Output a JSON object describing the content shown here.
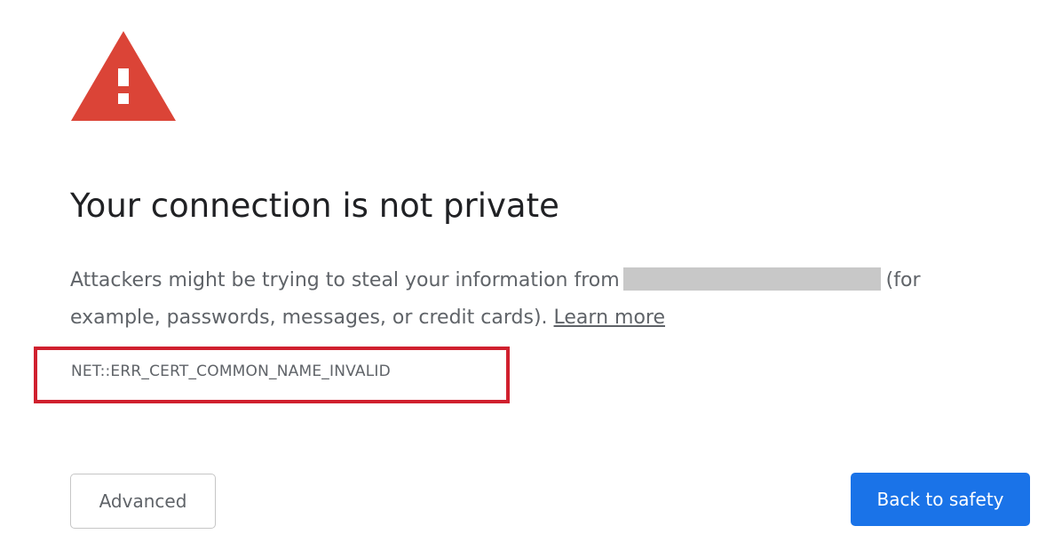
{
  "interstitial": {
    "title": "Your connection is not private",
    "description_before": "Attackers might be trying to steal your information from",
    "description_after": "(for example, passwords, messages, or credit cards).",
    "learn_more_label": "Learn more",
    "error_code": "NET::ERR_CERT_COMMON_NAME_INVALID",
    "icon": "warning-triangle-icon"
  },
  "buttons": {
    "advanced_label": "Advanced",
    "back_to_safety_label": "Back to safety"
  },
  "colors": {
    "warning_red": "#db4437",
    "primary_blue": "#1a73e8",
    "highlight_red": "#d0202e",
    "text_gray": "#5f6368",
    "title_dark": "#202124"
  }
}
